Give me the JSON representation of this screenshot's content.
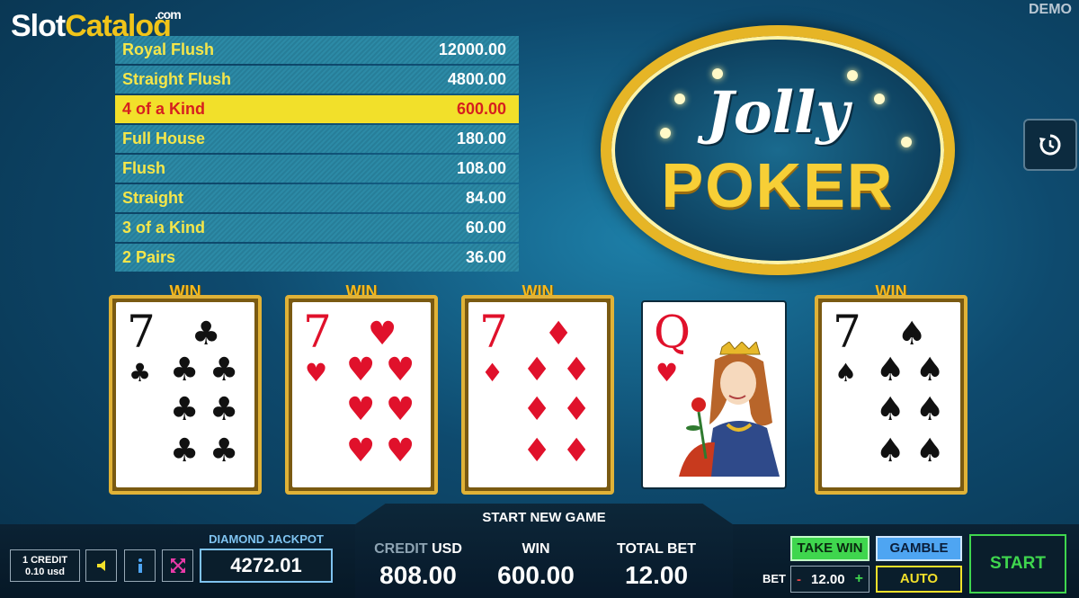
{
  "watermark": {
    "part_a": "Slot",
    "part_b": "Catalog",
    "suffix": ".com"
  },
  "mode_badge": "DEMO",
  "paytable": [
    {
      "hand": "Royal Flush",
      "value": "12000.00",
      "active": false
    },
    {
      "hand": "Straight Flush",
      "value": "4800.00",
      "active": false
    },
    {
      "hand": "4 of a Kind",
      "value": "600.00",
      "active": true
    },
    {
      "hand": "Full House",
      "value": "180.00",
      "active": false
    },
    {
      "hand": "Flush",
      "value": "108.00",
      "active": false
    },
    {
      "hand": "Straight",
      "value": "84.00",
      "active": false
    },
    {
      "hand": "3 of a Kind",
      "value": "60.00",
      "active": false
    },
    {
      "hand": "2 Pairs",
      "value": "36.00",
      "active": false
    }
  ],
  "logo": {
    "line1": "Jolly",
    "line2": "POKER"
  },
  "win_label": "WIN",
  "cards": [
    {
      "rank": "7",
      "suit": "clubs",
      "glyph": "♣",
      "color": "black",
      "win": true
    },
    {
      "rank": "7",
      "suit": "hearts",
      "glyph": "♥",
      "color": "red",
      "win": true
    },
    {
      "rank": "7",
      "suit": "diamonds",
      "glyph": "♦",
      "color": "red",
      "win": true
    },
    {
      "rank": "Q",
      "suit": "hearts",
      "glyph": "♥",
      "color": "red",
      "win": false
    },
    {
      "rank": "7",
      "suit": "spades",
      "glyph": "♠",
      "color": "black",
      "win": true
    }
  ],
  "bottom": {
    "start_new_game": "START NEW GAME",
    "credit_line1": "1 CREDIT",
    "credit_line2": "0.10 usd",
    "jackpot_label": "DIAMOND JACKPOT",
    "jackpot_value": "4272.01",
    "credit_label_dim": "CREDIT",
    "credit_label_unit": "USD",
    "credit_value": "808.00",
    "win_label": "WIN",
    "win_value": "600.00",
    "total_bet_label": "TOTAL BET",
    "total_bet_value": "12.00",
    "take_win": "TAKE WIN",
    "gamble": "GAMBLE",
    "bet_label": "BET",
    "bet_minus": "-",
    "bet_value": "12.00",
    "bet_plus": "+",
    "auto": "AUTO",
    "start": "START"
  },
  "colors": {
    "accent_gold": "#e0b237",
    "highlight_row": "#f2e02a",
    "take_win": "#3fd64e",
    "gamble": "#4ea5f2"
  },
  "icons": [
    "history-icon",
    "sound-icon",
    "info-icon",
    "fullscreen-icon"
  ]
}
